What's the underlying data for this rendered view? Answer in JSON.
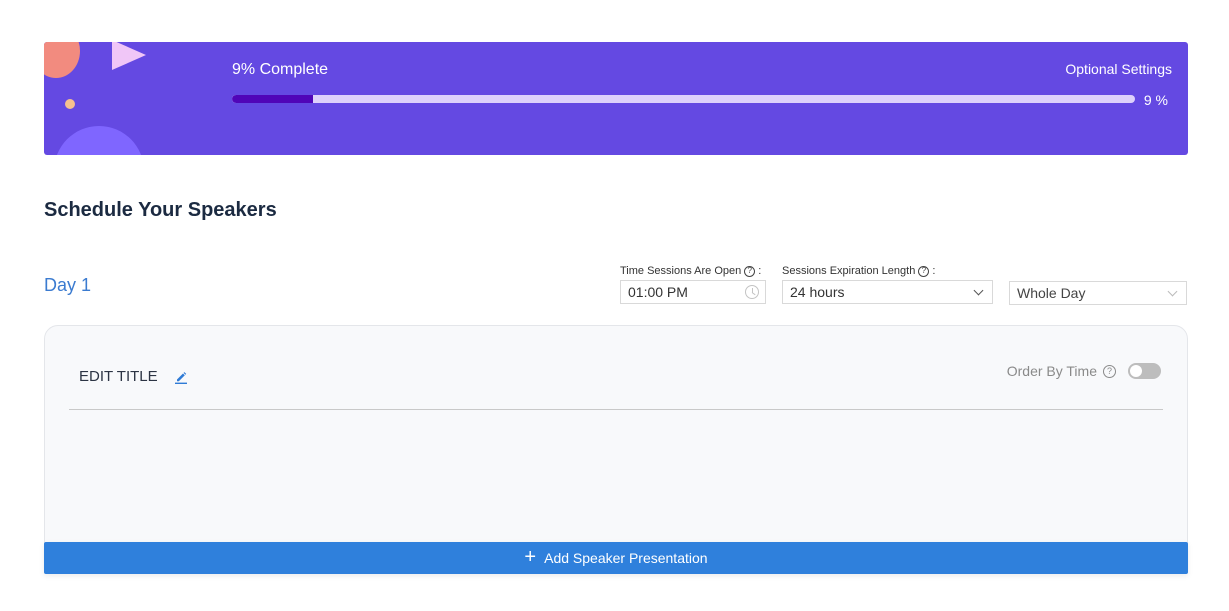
{
  "banner": {
    "progress_label": "9% Complete",
    "optional_settings": "Optional Settings",
    "progress_percent": 9,
    "progress_percent_text": "9 %",
    "colors": {
      "background": "#6449e2",
      "fill": "#5005b8",
      "track": "#ddd1fb"
    }
  },
  "section": {
    "title": "Schedule Your Speakers"
  },
  "day": {
    "label": "Day 1",
    "time_open": {
      "label": "Time Sessions Are Open",
      "suffix": ":",
      "value": "01:00 PM",
      "help_icon": "question-circle-icon",
      "icon": "clock-icon"
    },
    "expiration": {
      "label": "Sessions Expiration Length",
      "suffix": ":",
      "value": "24 hours",
      "help_icon": "question-circle-icon",
      "icon": "chevron-down-icon"
    },
    "range": {
      "value": "Whole Day",
      "icon": "chevron-down-icon"
    }
  },
  "card": {
    "edit_title": "EDIT TITLE",
    "edit_icon": "pencil-icon",
    "order_by_label": "Order By Time",
    "order_by_enabled": false
  },
  "add_button": {
    "label": "Add Speaker Presentation",
    "icon": "plus-icon",
    "color": "#2f80dc"
  }
}
